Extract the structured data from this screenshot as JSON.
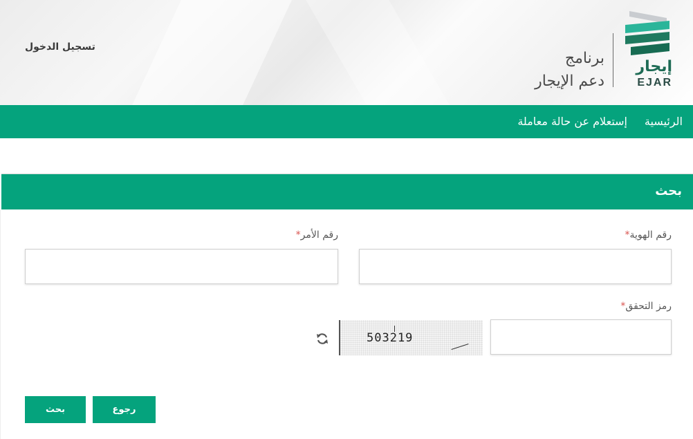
{
  "header": {
    "login_label": "تسجيل الدخول",
    "program_line1": "برنامج",
    "program_line2": "دعم الإيجار",
    "logo_ar": "إيجار",
    "logo_en": "EJAR",
    "logo_colors": [
      "#c9ccd0",
      "#2bb59a",
      "#1f7a5f",
      "#176b52"
    ]
  },
  "nav": {
    "items": [
      {
        "label": "الرئيسية"
      },
      {
        "label": "إستعلام عن حالة معاملة"
      }
    ]
  },
  "panel": {
    "title": "بحث"
  },
  "form": {
    "id_number_label": "رقم الهوية",
    "order_number_label": "رقم الأمر",
    "captcha_label": "رمز التحقق",
    "required_mark": "*",
    "id_number_value": "",
    "order_number_value": "",
    "captcha_value": "",
    "captcha_code": "503219"
  },
  "buttons": {
    "back_label": "رجوع",
    "search_label": "بحث"
  },
  "colors": {
    "primary": "#05a37d",
    "required": "#d9534f"
  }
}
